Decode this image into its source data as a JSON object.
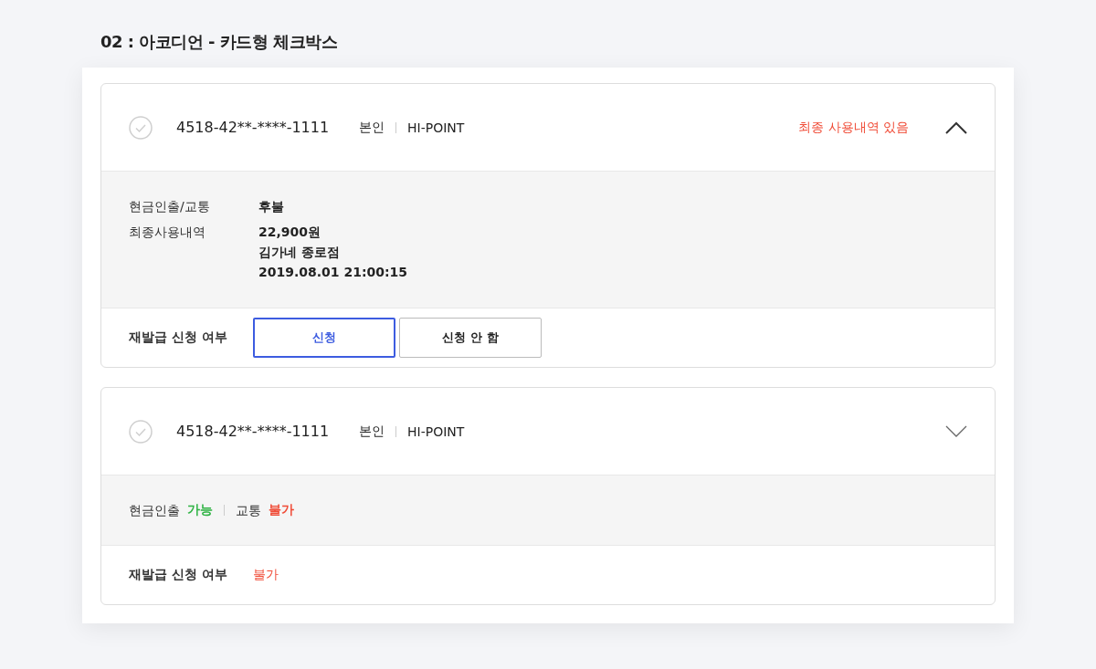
{
  "title": "02 : 아코디언 - 카드형 체크박스",
  "cards": [
    {
      "checked": false,
      "number": "4518-42**-****-1111",
      "owner": "본인",
      "type": "HI-POINT",
      "status": "최종 사용내역 있음",
      "expanded": true,
      "body": {
        "kind": "details",
        "rows": [
          {
            "label": "현금인출/교통",
            "values": [
              "후불"
            ]
          },
          {
            "label": "최종사용내역",
            "values": [
              "22,900원",
              "김가네 종로점",
              "2019.08.01 21:00:15"
            ]
          }
        ]
      },
      "reissue": {
        "label": "재발급 신청 여부",
        "kind": "choice",
        "options": [
          {
            "label": "신청",
            "selected": true
          },
          {
            "label": "신청 안 함",
            "selected": false
          }
        ]
      }
    },
    {
      "checked": false,
      "number": "4518-42**-****-1111",
      "owner": "본인",
      "type": "HI-POINT",
      "expanded": false,
      "body": {
        "kind": "availability",
        "items": [
          {
            "label": "현금인출",
            "value": "가능",
            "available": true
          },
          {
            "label": "교통",
            "value": "불가",
            "available": false
          }
        ]
      },
      "reissue": {
        "label": "재발급 신청 여부",
        "kind": "text",
        "value": "불가",
        "available": false
      }
    }
  ]
}
